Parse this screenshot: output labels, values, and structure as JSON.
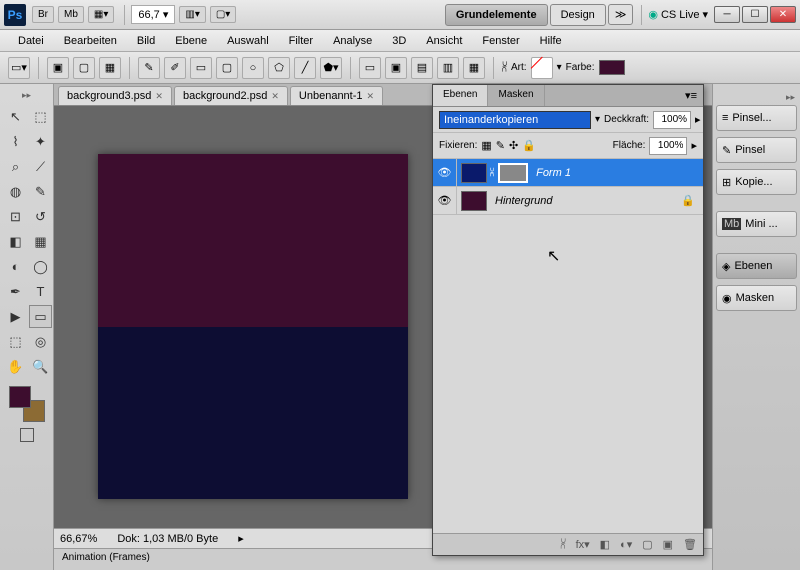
{
  "app": {
    "id": "Ps"
  },
  "topbar": {
    "zoom": "66,7",
    "workspaces": [
      "Grundelemente",
      "Design"
    ],
    "cs_live": "CS Live"
  },
  "menubar": [
    "Datei",
    "Bearbeiten",
    "Bild",
    "Ebene",
    "Auswahl",
    "Filter",
    "Analyse",
    "3D",
    "Ansicht",
    "Fenster",
    "Hilfe"
  ],
  "optionsbar": {
    "art": "Art:",
    "farbe": "Farbe:",
    "farbe_color": "#3d0d2e"
  },
  "doc_tabs": [
    "background3.psd",
    "background2.psd",
    "Unbenannt-1"
  ],
  "statusbar": {
    "zoom": "66,67%",
    "dok": "Dok: 1,03 MB/0 Byte"
  },
  "anim_panel": "Animation (Frames)",
  "layers_panel": {
    "tabs": [
      "Ebenen",
      "Masken"
    ],
    "blend_mode": "Ineinanderkopieren",
    "deckkraft_label": "Deckkraft:",
    "deckkraft_value": "100%",
    "fixieren": "Fixieren:",
    "flaeche_label": "Fläche:",
    "flaeche_value": "100%",
    "layers": [
      {
        "name": "Form 1",
        "color": "#0a1a6b",
        "mask": "#888",
        "selected": true
      },
      {
        "name": "Hintergrund",
        "color": "#3d0d2e",
        "locked": true
      }
    ]
  },
  "right_dock": [
    "Pinsel...",
    "Pinsel",
    "Kopie...",
    "Mini ...",
    "Ebenen",
    "Masken"
  ],
  "fg_color": "#3d0d2e",
  "bg_color": "#8c6b34",
  "canvas_top_color": "#3d0d2e",
  "canvas_bot_color": "#0d0d33"
}
